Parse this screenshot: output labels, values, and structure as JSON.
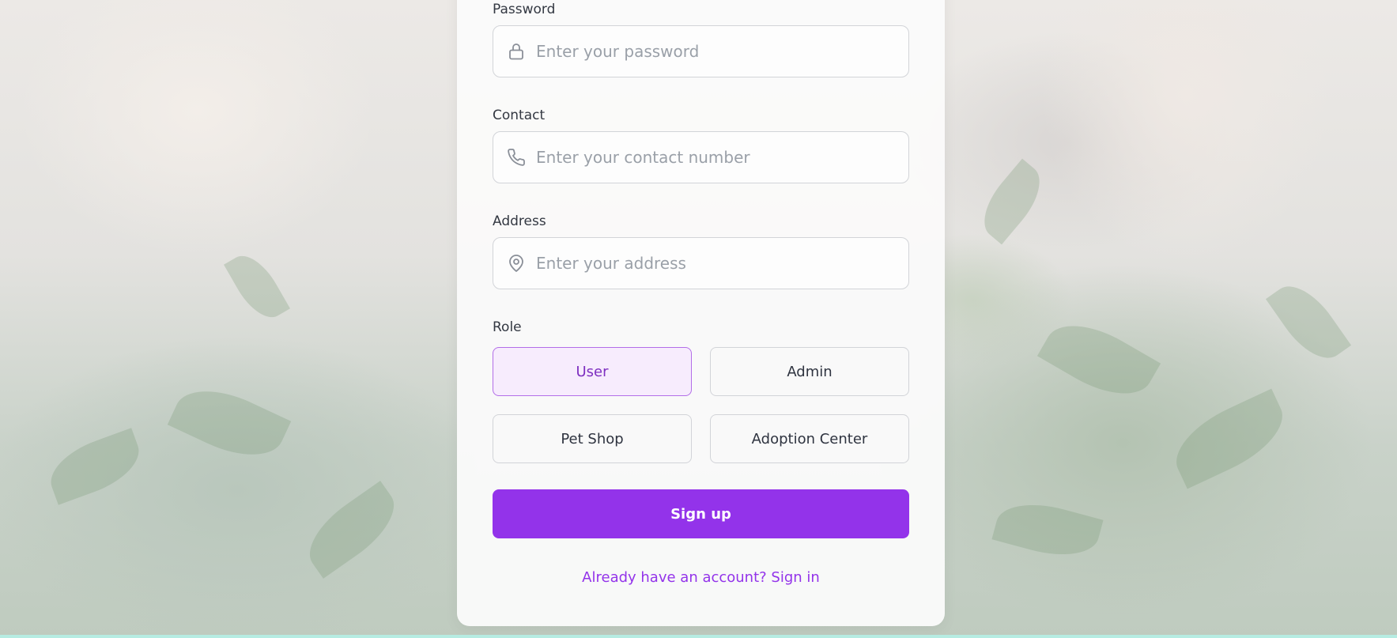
{
  "form": {
    "password": {
      "label": "Password",
      "placeholder": "Enter your password",
      "icon": "lock-icon"
    },
    "contact": {
      "label": "Contact",
      "placeholder": "Enter your contact number",
      "icon": "phone-icon"
    },
    "address": {
      "label": "Address",
      "placeholder": "Enter your address",
      "icon": "map-pin-icon"
    },
    "role": {
      "label": "Role",
      "options": [
        "User",
        "Admin",
        "Pet Shop",
        "Adoption Center"
      ],
      "selected": "User"
    },
    "submit_label": "Sign up",
    "signin_link": "Already have an account? Sign in"
  },
  "colors": {
    "accent": "#9333ea",
    "selected_bg": "#f7ecfd",
    "selected_border": "#b36ee8",
    "card_bg": "#fafafa"
  }
}
